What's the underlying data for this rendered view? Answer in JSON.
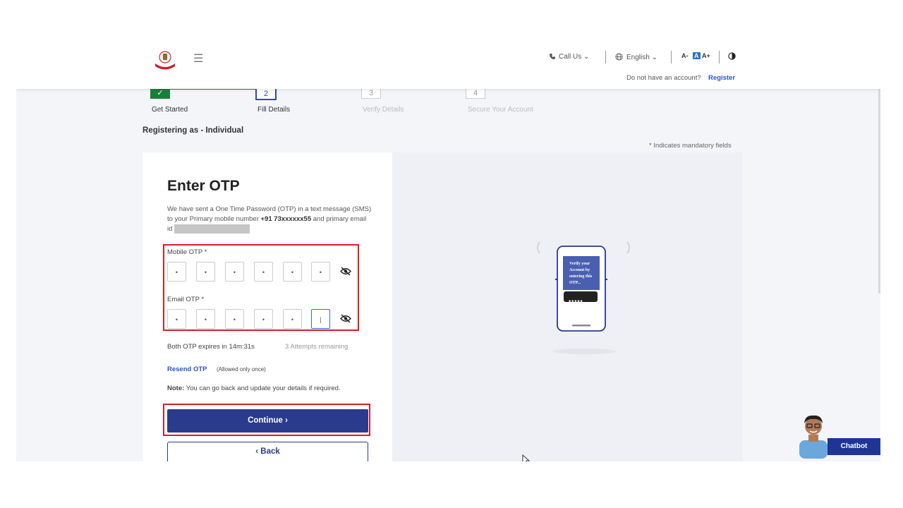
{
  "header": {
    "call_us": "Call Us",
    "language": "English",
    "font_small": "A-",
    "font_normal": "A",
    "font_large": "A+",
    "no_account": "Do not have an account?",
    "register": "Register"
  },
  "stepper": {
    "steps": [
      {
        "number": "",
        "label": "Get Started",
        "state": "done"
      },
      {
        "number": "2",
        "label": "Fill Details",
        "state": "active"
      },
      {
        "number": "3",
        "label": "Verify Details",
        "state": "pending"
      },
      {
        "number": "4",
        "label": "Secure Your Account",
        "state": "pending"
      }
    ]
  },
  "registering_as": "Registering as - Individual",
  "mandatory_note": "* Indicates mandatory fields",
  "form": {
    "title": "Enter OTP",
    "desc_1": "We have sent a One Time Password (OTP) in a text message (SMS) to your Primary mobile number ",
    "mobile_number": "+91 73xxxxxx55",
    "desc_2": " and primary email id ",
    "mobile_otp_label": "Mobile OTP *",
    "mobile_otp_digits": [
      "•",
      "•",
      "•",
      "•",
      "•",
      "•"
    ],
    "email_otp_label": "Email OTP *",
    "email_otp_digits": [
      "•",
      "•",
      "•",
      "•",
      "•",
      "|"
    ],
    "expiry": "Both OTP expires in 14m:31s",
    "attempts": "3 Attempts remaining",
    "resend": "Resend OTP",
    "resend_note": "(Allowed only once)",
    "note_label": "Note:",
    "note_text": " You can go back and update your details if required.",
    "continue": "Continue",
    "back": "Back"
  },
  "illustration": {
    "phone_text": "Verify your Account by entering this OTP...",
    "bubble_text": "*****"
  },
  "chatbot": "Chatbot",
  "colors": {
    "primary": "#2a3a8c",
    "link": "#2a55c9",
    "done_green": "#1a7f3b",
    "highlight_red": "#d81e25"
  }
}
